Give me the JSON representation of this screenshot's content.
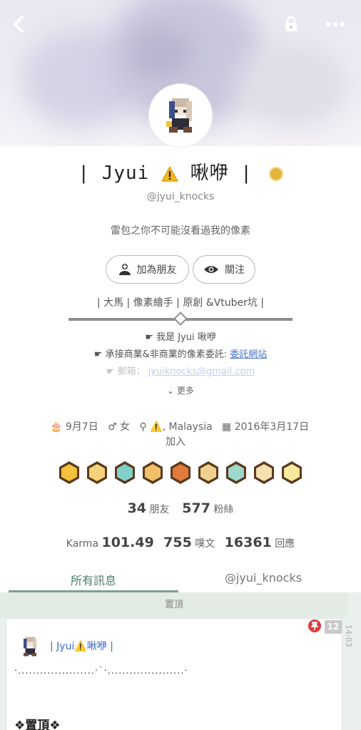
{
  "nav": {
    "back_icon": "chevron-left-icon",
    "lock_icon": "lock-icon",
    "more_icon": "ellipsis-icon"
  },
  "profile": {
    "name_left": "| Jyui",
    "name_right": "啾咿 |",
    "handle": "@jyui_knocks",
    "bio": "雷包之你不可能沒看過我的像素"
  },
  "actions": {
    "add_friend": "加為朋友",
    "follow": "關注"
  },
  "about": {
    "tags": "| 大馬 | 像素繪手 | 原創 &Vtuber坑 |",
    "line1": "我是 Jyui 啾咿",
    "line2_prefix": "承接商業&非商業的像素委託: ",
    "line2_link": "委託網站",
    "line3_prefix": "郵箱： ",
    "line3_link": "jyuiknocks@gmail.com",
    "more": "更多"
  },
  "meta": {
    "birthday": "9月7日",
    "gender": "女",
    "location": ", Malaysia",
    "joined_date": "2016年3月17日",
    "joined_suffix": "加入"
  },
  "badges": [
    "karma-100-badge",
    "eye-pyramid-badge",
    "heart-badge",
    "pencil-badge",
    "chat-badge",
    "person-badge",
    "gift-badge",
    "bone-badge",
    "coin-badge"
  ],
  "stats": {
    "friends_count": "34",
    "friends_label": "朋友",
    "fans_count": "577",
    "fans_label": "粉絲",
    "karma_label": "Karma",
    "karma_value": "101.49",
    "posts_count": "755",
    "posts_label": "噗文",
    "replies_count": "16361",
    "replies_label": "回應"
  },
  "tabs": {
    "all": "所有訊息",
    "user": "@jyui_knocks"
  },
  "feed": {
    "pinned_label": "置頂",
    "count": "12",
    "time": "14:03",
    "post_name_left": "| Jyui",
    "post_name_right": "啾咿 |",
    "post_dots": "‧.....................‧˙‧.....................‧",
    "post_pinned_text": "❖置頂❖"
  },
  "colors": {
    "accent": "#4f7d6a",
    "link": "#4a74c9",
    "badge_border": "#5a3a1e"
  }
}
